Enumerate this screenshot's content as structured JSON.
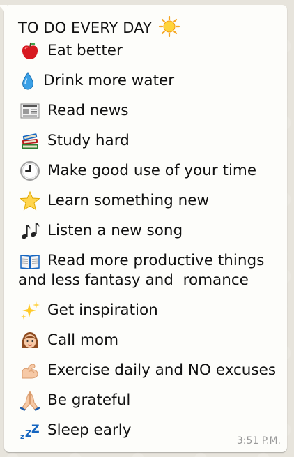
{
  "message": {
    "title": "TO DO EVERY DAY",
    "title_icon": "sun-icon",
    "timestamp": "3:51 P.M.",
    "items": [
      {
        "icon": "apple-icon",
        "text": "Eat better"
      },
      {
        "icon": "water-drop-icon",
        "text": "Drink more water"
      },
      {
        "icon": "newspaper-icon",
        "text": "Read news"
      },
      {
        "icon": "books-icon",
        "text": "Study hard"
      },
      {
        "icon": "clock-icon",
        "text": "Make good use of your time"
      },
      {
        "icon": "star-icon",
        "text": "Learn something new"
      },
      {
        "icon": "music-notes-icon",
        "text": "Listen a new song"
      },
      {
        "icon": "open-book-icon",
        "text": "Read more productive things and less fantasy and  romance"
      },
      {
        "icon": "sparkles-icon",
        "text": "Get inspiration"
      },
      {
        "icon": "woman-icon",
        "text": "Call mom"
      },
      {
        "icon": "flexed-biceps-icon",
        "text": "Exercise daily and NO excuses"
      },
      {
        "icon": "praying-hands-icon",
        "text": "Be grateful"
      },
      {
        "icon": "sleeping-zzz-icon",
        "text": "Sleep early"
      }
    ]
  },
  "colors": {
    "background": "#e7e4dc",
    "bubble": "#fdfdfa",
    "text": "#111111",
    "timestamp": "#999999"
  }
}
